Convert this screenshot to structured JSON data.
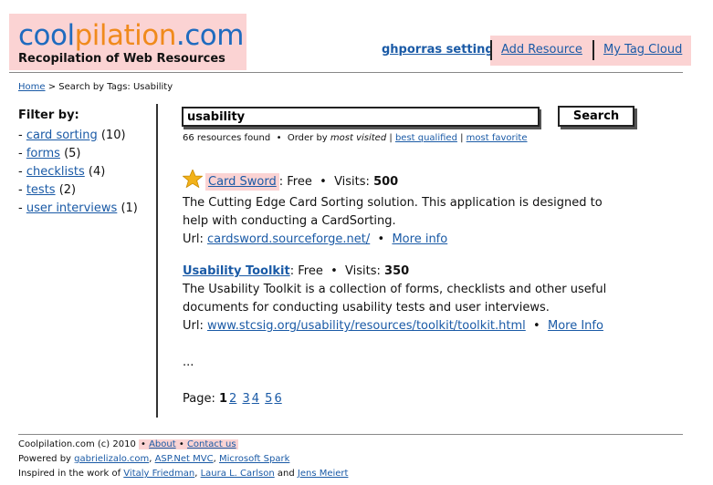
{
  "header": {
    "logo_part1": "cool",
    "logo_part2": "pilation",
    "logo_part3": ".com",
    "tagline": "Recopilation of Web Resources",
    "user_settings": "ghporras settings",
    "add_resource": "Add Resource",
    "tag_cloud": "My Tag Cloud"
  },
  "breadcrumb": {
    "home": "Home",
    "separator": ">",
    "current": "Search by Tags: Usability"
  },
  "filters": {
    "title": "Filter by:",
    "items": [
      {
        "label": "card sorting",
        "count": "(10)"
      },
      {
        "label": "forms",
        "count": "(5)"
      },
      {
        "label": "checklists",
        "count": "(4)"
      },
      {
        "label": "tests",
        "count": "(2)"
      },
      {
        "label": "user interviews",
        "count": "(1)"
      }
    ]
  },
  "search": {
    "value": "usability",
    "button_label": "Search"
  },
  "results_summary": {
    "count_text": "66 resources found",
    "bullet": "•",
    "order_prefix": "Order by",
    "order_current": "most visited",
    "sep": "|",
    "order_best": "best qualified",
    "order_fav": "most favorite"
  },
  "results": [
    {
      "title": "Card Sword",
      "price": ": Free",
      "visits_label": "Visits:",
      "visits": "500",
      "description": "The Cutting Edge Card Sorting solution. This application is designed to help with conducting a CardSorting.",
      "url_label": "Url:",
      "url": "cardsword.sourceforge.net/",
      "more": "More info"
    },
    {
      "title": "Usability Toolkit",
      "price": ": Free",
      "visits_label": "Visits:",
      "visits": "350",
      "description": "The Usability Toolkit is a collection of forms, checklists and other useful documents for conducting usability tests and user interviews.",
      "url_label": "Url:",
      "url": "www.stcsig.org/usability/resources/toolkit/toolkit.html",
      "more": "More Info"
    }
  ],
  "ellipsis": "...",
  "pager": {
    "label": "Page:",
    "current": "1",
    "pages": [
      "2",
      "3",
      "4",
      "5",
      "6"
    ]
  },
  "footer": {
    "copyright": "Coolpilation.com (c) 2010",
    "about": "About",
    "contact": "Contact us",
    "powered_prefix": "Powered by",
    "powered_1": "gabrielizalo.com",
    "powered_2": "ASP.Net MVC",
    "powered_3": "Microsoft Spark",
    "inspired_prefix": "Inspired in the work of",
    "inspired_1": "Vitaly Friedman",
    "inspired_2": "Laura L. Carlson",
    "inspired_and": "and",
    "inspired_3": "Jens Meiert"
  },
  "colors": {
    "pink_highlight": "#fbd3d3",
    "logo_blue": "#1f6bbf",
    "logo_orange": "#f08a1c",
    "link_blue": "#1a5aa6",
    "star_gold": "#f2b21a"
  },
  "icons": {
    "featured": "star-icon"
  }
}
